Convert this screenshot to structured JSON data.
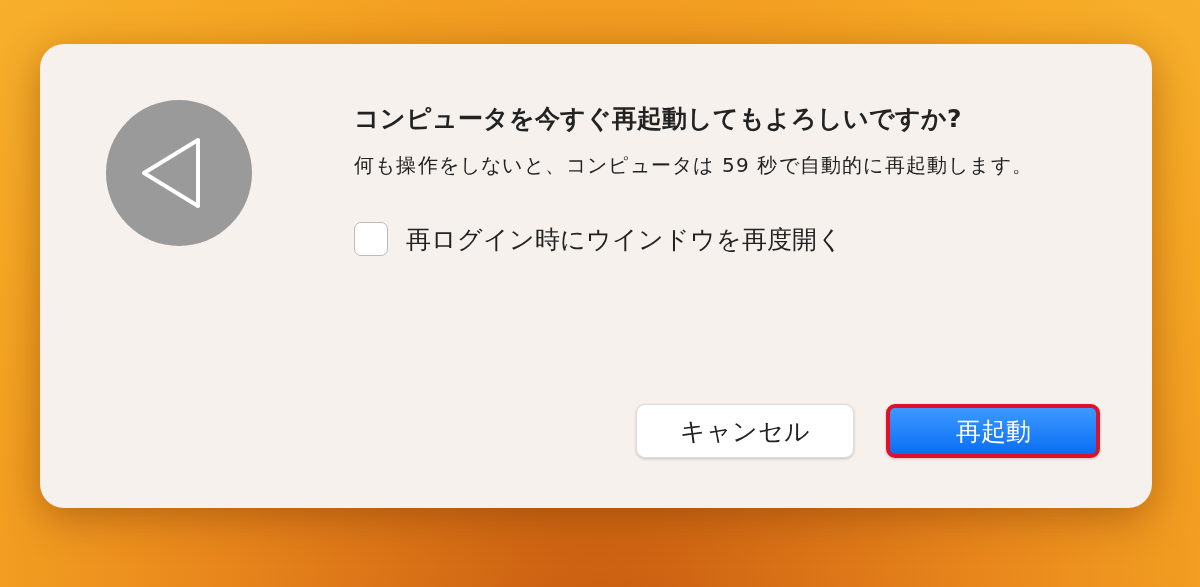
{
  "dialog": {
    "title": "コンピュータを今すぐ再起動してもよろしいですか?",
    "message": "何も操作をしないと、コンピュータは 59 秒で自動的に再起動します。",
    "checkbox": {
      "label": "再ログイン時にウインドウを再度開く",
      "checked": false
    },
    "buttons": [
      {
        "label": "キャンセル",
        "kind": "secondary",
        "highlighted": false
      },
      {
        "label": "再起動",
        "kind": "primary",
        "highlighted": true
      }
    ]
  }
}
